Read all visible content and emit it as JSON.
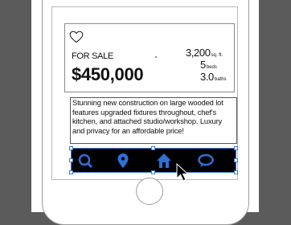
{
  "listing": {
    "status": "FOR SALE",
    "price": "$450,000",
    "area_value": "3,200",
    "area_unit": "sq. ft.",
    "beds_value": "5",
    "beds_unit": "beds",
    "baths_value": "3.0",
    "baths_unit": "baths",
    "description": "Stunning new construction on large wooded lot features upgraded fixtures throughout, chef's kitchen, and attached studio/workshop. Luxury and privacy for an affordable price!"
  },
  "toolbar": {
    "icons": [
      "search-icon",
      "location-pin-icon",
      "home-icon",
      "chat-bubble-icon"
    ]
  },
  "colors": {
    "selection": "#3d7bd6",
    "toolbar_bg": "#000000",
    "icon": "#2f6fd6"
  }
}
